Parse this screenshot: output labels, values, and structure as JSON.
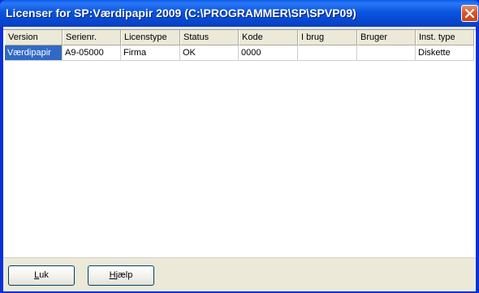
{
  "window": {
    "title": "Licenser for SP:Værdipapir 2009 (C:\\PROGRAMMER\\SP\\SPVP09)",
    "close_icon": "close-icon"
  },
  "table": {
    "columns": [
      "Version",
      "Serienr.",
      "Licenstype",
      "Status",
      "Kode",
      "I brug",
      "Bruger",
      "Inst. type"
    ],
    "rows": [
      [
        "Værdipapir",
        "A9-05000",
        "Firma",
        "OK",
        "0000",
        "",
        "",
        "Diskette"
      ]
    ],
    "selected_row": 0
  },
  "buttons": {
    "close_mnemonic": "L",
    "close_rest": "uk",
    "help_mnemonic": "H",
    "help_rest": "jælp"
  },
  "colors": {
    "title_bar": "#0a55df",
    "selection": "#316ac5",
    "close_button": "#d8552b"
  }
}
